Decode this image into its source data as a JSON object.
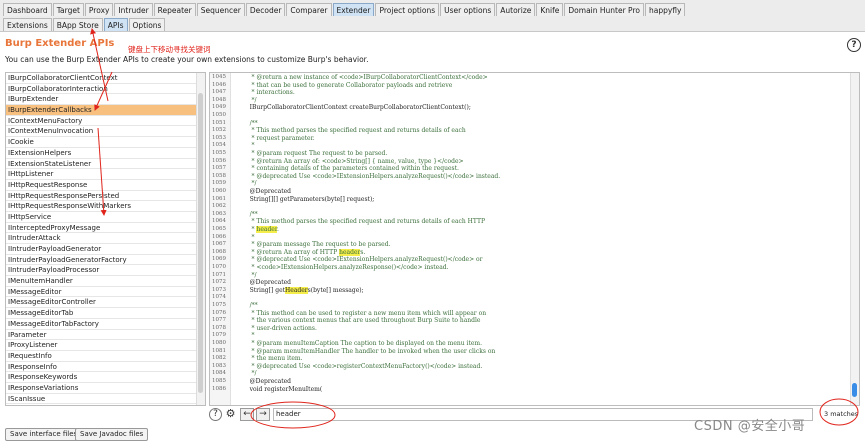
{
  "main_tabs": [
    "Dashboard",
    "Target",
    "Proxy",
    "Intruder",
    "Repeater",
    "Sequencer",
    "Decoder",
    "Comparer",
    "Extender",
    "Project options",
    "User options",
    "Autorize",
    "Knife",
    "Domain Hunter Pro",
    "happyfly"
  ],
  "main_tab_active": "Extender",
  "sub_tabs": [
    "Extensions",
    "BApp Store",
    "APIs",
    "Options"
  ],
  "sub_tab_active": "APIs",
  "title": "Burp Extender APIs",
  "subtitle": "You can use the Burp Extender APIs to create your own extensions to customize Burp's behavior.",
  "annotation": "键盘上下移动寻找关键词",
  "help_label": "?",
  "api_list": [
    "IBurpCollaboratorClientContext",
    "IBurpCollaboratorInteraction",
    "IBurpExtender",
    "IBurpExtenderCallbacks",
    "IContextMenuFactory",
    "IContextMenuInvocation",
    "ICookie",
    "IExtensionHelpers",
    "IExtensionStateListener",
    "IHttpListener",
    "IHttpRequestResponse",
    "IHttpRequestResponsePersisted",
    "IHttpRequestResponseWithMarkers",
    "IHttpService",
    "IInterceptedProxyMessage",
    "IIntruderAttack",
    "IIntruderPayloadGenerator",
    "IIntruderPayloadGeneratorFactory",
    "IIntruderPayloadProcessor",
    "IMenuItemHandler",
    "IMessageEditor",
    "IMessageEditorController",
    "IMessageEditorTab",
    "IMessageEditorTabFactory",
    "IParameter",
    "IProxyListener",
    "IRequestInfo",
    "IResponseInfo",
    "IResponseKeywords",
    "IResponseVariations",
    "IScanIssue",
    "IScanQueueItem"
  ],
  "api_selected": "IBurpExtenderCallbacks",
  "code_lines": [
    {
      "n": "1045",
      "t": "     * @return a new instance of <code>IBurpCollaboratorClientContext</code>",
      "c": true
    },
    {
      "n": "1046",
      "t": "     * that can be used to generate Collaborator payloads and retrieve",
      "c": true
    },
    {
      "n": "1047",
      "t": "     * interactions.",
      "c": true
    },
    {
      "n": "1048",
      "t": "     */",
      "c": true
    },
    {
      "n": "1049",
      "t": "    IBurpCollaboratorClientContext createBurpCollaboratorClientContext();",
      "c": false
    },
    {
      "n": "1050",
      "t": "",
      "c": false
    },
    {
      "n": "1051",
      "t": "    /**",
      "c": true
    },
    {
      "n": "1052",
      "t": "     * This method parses the specified request and returns details of each",
      "c": true
    },
    {
      "n": "1053",
      "t": "     * request parameter.",
      "c": true
    },
    {
      "n": "1054",
      "t": "     *",
      "c": true
    },
    {
      "n": "1055",
      "t": "     * @param request The request to be parsed.",
      "c": true
    },
    {
      "n": "1056",
      "t": "     * @return An array of: <code>String[] { name, value, type }</code>",
      "c": true
    },
    {
      "n": "1057",
      "t": "     * containing details of the parameters contained within the request.",
      "c": true
    },
    {
      "n": "1058",
      "t": "     * @deprecated Use <code>IExtensionHelpers.analyzeRequest()</code> instead.",
      "c": true
    },
    {
      "n": "1059",
      "t": "     */",
      "c": true
    },
    {
      "n": "1060",
      "t": "    @Deprecated",
      "c": false
    },
    {
      "n": "1061",
      "t": "    String[][] getParameters(byte[] request);",
      "c": false
    },
    {
      "n": "1062",
      "t": "",
      "c": false
    },
    {
      "n": "1063",
      "t": "    /**",
      "c": true
    },
    {
      "n": "1064",
      "t": "     * This method parses the specified request and returns details of each HTTP",
      "c": true
    },
    {
      "n": "1065",
      "t": "     * header.",
      "c": true,
      "hl": "header"
    },
    {
      "n": "1066",
      "t": "     *",
      "c": true
    },
    {
      "n": "1067",
      "t": "     * @param message The request to be parsed.",
      "c": true
    },
    {
      "n": "1068",
      "t": "     * @return An array of HTTP headers.",
      "c": true,
      "hl": "header"
    },
    {
      "n": "1069",
      "t": "     * @deprecated Use <code>IExtensionHelpers.analyzeRequest()</code> or",
      "c": true
    },
    {
      "n": "1070",
      "t": "     * <code>IExtensionHelpers.analyzeResponse()</code> instead.",
      "c": true
    },
    {
      "n": "1071",
      "t": "     */",
      "c": true
    },
    {
      "n": "1072",
      "t": "    @Deprecated",
      "c": false
    },
    {
      "n": "1073",
      "t": "    String[] getHeaders(byte[] message);",
      "c": false,
      "hl": "Header"
    },
    {
      "n": "1074",
      "t": "",
      "c": false
    },
    {
      "n": "1075",
      "t": "    /**",
      "c": true
    },
    {
      "n": "1076",
      "t": "     * This method can be used to register a new menu item which will appear on",
      "c": true
    },
    {
      "n": "1077",
      "t": "     * the various context menus that are used throughout Burp Suite to handle",
      "c": true
    },
    {
      "n": "1078",
      "t": "     * user-driven actions.",
      "c": true
    },
    {
      "n": "1079",
      "t": "     *",
      "c": true
    },
    {
      "n": "1080",
      "t": "     * @param menuItemCaption The caption to be displayed on the menu item.",
      "c": true
    },
    {
      "n": "1081",
      "t": "     * @param menuItemHandler The handler to be invoked when the user clicks on",
      "c": true
    },
    {
      "n": "1082",
      "t": "     * the menu item.",
      "c": true
    },
    {
      "n": "1083",
      "t": "     * @deprecated Use <code>registerContextMenuFactory()</code> instead.",
      "c": true
    },
    {
      "n": "1084",
      "t": "     */",
      "c": true
    },
    {
      "n": "1085",
      "t": "    @Deprecated",
      "c": false
    },
    {
      "n": "1086",
      "t": "    void registerMenuItem(",
      "c": false
    }
  ],
  "search": {
    "value": "header",
    "matches": "3 matches"
  },
  "buttons": {
    "save_interface": "Save interface files",
    "save_javadoc": "Save Javadoc files"
  },
  "icons": {
    "help": "?",
    "gear": "⚙",
    "prev": "←",
    "next": "→"
  },
  "watermark": "CSDN @安全小哥",
  "colors": {
    "title": "#e8753a",
    "selection": "#f8c07e",
    "highlight": "#f5ee4a",
    "annotation": "#e0241b",
    "active_tab": "#cfe3f5"
  }
}
